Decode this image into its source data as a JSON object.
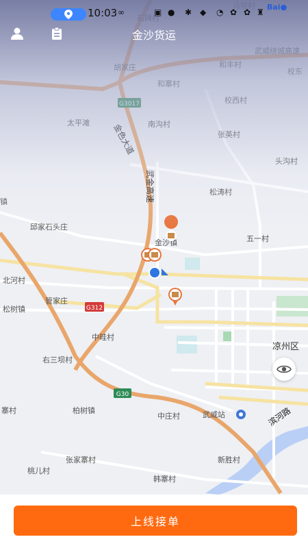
{
  "status_bar": {
    "time": "10:03"
  },
  "header": {
    "title": "金沙货运"
  },
  "map": {
    "places": [
      "马坝村",
      "石碑村",
      "和丰村",
      "武威绕城高速",
      "胡家庄",
      "校东",
      "和寨村",
      "校西村",
      "太平滩",
      "南沟村",
      "张英村",
      "头沟村",
      "松涛村",
      "镇",
      "邱家石头庄",
      "金沙镇",
      "五一村",
      "北河村",
      "管家庄",
      "松树镇",
      "中畦村",
      "凉州区",
      "右三坝村",
      "寨村",
      "柏树镇",
      "中庄村",
      "武威站",
      "张家寨村",
      "新胜村",
      "桃儿村",
      "韩寨村"
    ],
    "road_labels": {
      "jinse": "金色大道",
      "wujin": "武金高速",
      "binhe": "滨河路"
    },
    "shields": {
      "g3017": "G3017",
      "g312": "G312",
      "g30": "G30"
    }
  },
  "bottom": {
    "online_button": "上线接单"
  }
}
